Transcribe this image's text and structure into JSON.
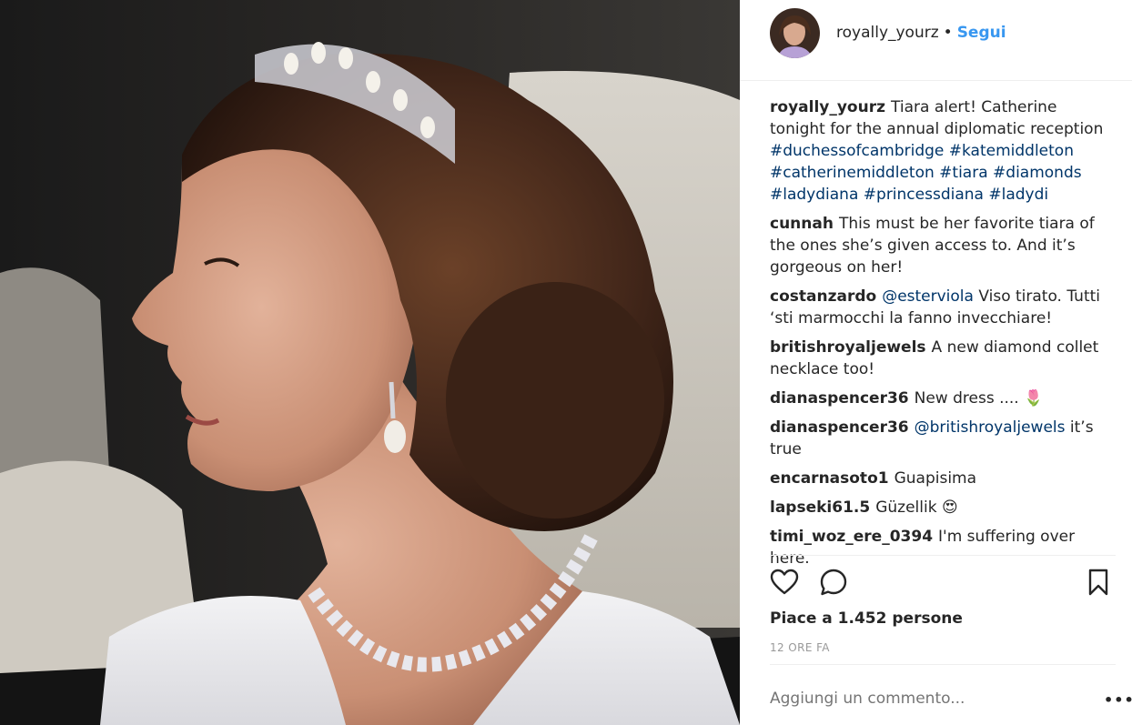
{
  "post": {
    "username": "royally_yourz",
    "separator": "•",
    "follow_label": "Segui",
    "image_alt": "Photo of a woman in a car wearing a pearl tiara, pearl drop earring and diamond necklace"
  },
  "comments": [
    {
      "user": "royally_yourz",
      "parts": [
        {
          "type": "text",
          "value": "Tiara alert! Catherine tonight for the annual diplomatic reception "
        },
        {
          "type": "tag",
          "value": "#duchessofcambridge"
        },
        {
          "type": "text",
          "value": " "
        },
        {
          "type": "tag",
          "value": "#katemiddleton"
        },
        {
          "type": "text",
          "value": " "
        },
        {
          "type": "tag",
          "value": "#catherinemiddleton"
        },
        {
          "type": "text",
          "value": " "
        },
        {
          "type": "tag",
          "value": "#tiara"
        },
        {
          "type": "text",
          "value": " "
        },
        {
          "type": "tag",
          "value": "#diamonds"
        },
        {
          "type": "text",
          "value": " "
        },
        {
          "type": "tag",
          "value": "#ladydiana"
        },
        {
          "type": "text",
          "value": " "
        },
        {
          "type": "tag",
          "value": "#princessdiana"
        },
        {
          "type": "text",
          "value": " "
        },
        {
          "type": "tag",
          "value": "#ladydi"
        }
      ]
    },
    {
      "user": "cunnah",
      "parts": [
        {
          "type": "text",
          "value": "This must be her favorite tiara of the ones she’s given access to. And it’s gorgeous on her!"
        }
      ]
    },
    {
      "user": "costanzardo",
      "parts": [
        {
          "type": "tag",
          "value": "@esterviola"
        },
        {
          "type": "text",
          "value": " Viso tirato. Tutti ‘sti marmocchi la fanno invecchiare!"
        }
      ]
    },
    {
      "user": "britishroyaljewels",
      "parts": [
        {
          "type": "text",
          "value": "A new diamond collet necklace too!"
        }
      ]
    },
    {
      "user": "dianaspencer36",
      "parts": [
        {
          "type": "text",
          "value": "New dress .... 🌷"
        }
      ]
    },
    {
      "user": "dianaspencer36",
      "parts": [
        {
          "type": "tag",
          "value": "@britishroyaljewels"
        },
        {
          "type": "text",
          "value": " it’s true"
        }
      ]
    },
    {
      "user": "encarnasoto1",
      "parts": [
        {
          "type": "text",
          "value": "Guapisima"
        }
      ]
    },
    {
      "user": "lapseki61.5",
      "parts": [
        {
          "type": "text",
          "value": "Güzellik 😍"
        }
      ]
    },
    {
      "user": "timi_woz_ere_0394",
      "parts": [
        {
          "type": "text",
          "value": "I'm suffering over here."
        }
      ]
    }
  ],
  "actions": {
    "like_icon": "heart-icon",
    "comment_icon": "comment-bubble-icon",
    "save_icon": "bookmark-icon"
  },
  "likes_text": "Piace a 1.452 persone",
  "timestamp": "12 ORE FA",
  "add_comment": {
    "placeholder": "Aggiungi un commento...",
    "more_label": "•••"
  },
  "colors": {
    "link": "#003569",
    "follow": "#3897f0",
    "muted": "#999999",
    "text": "#262626"
  }
}
